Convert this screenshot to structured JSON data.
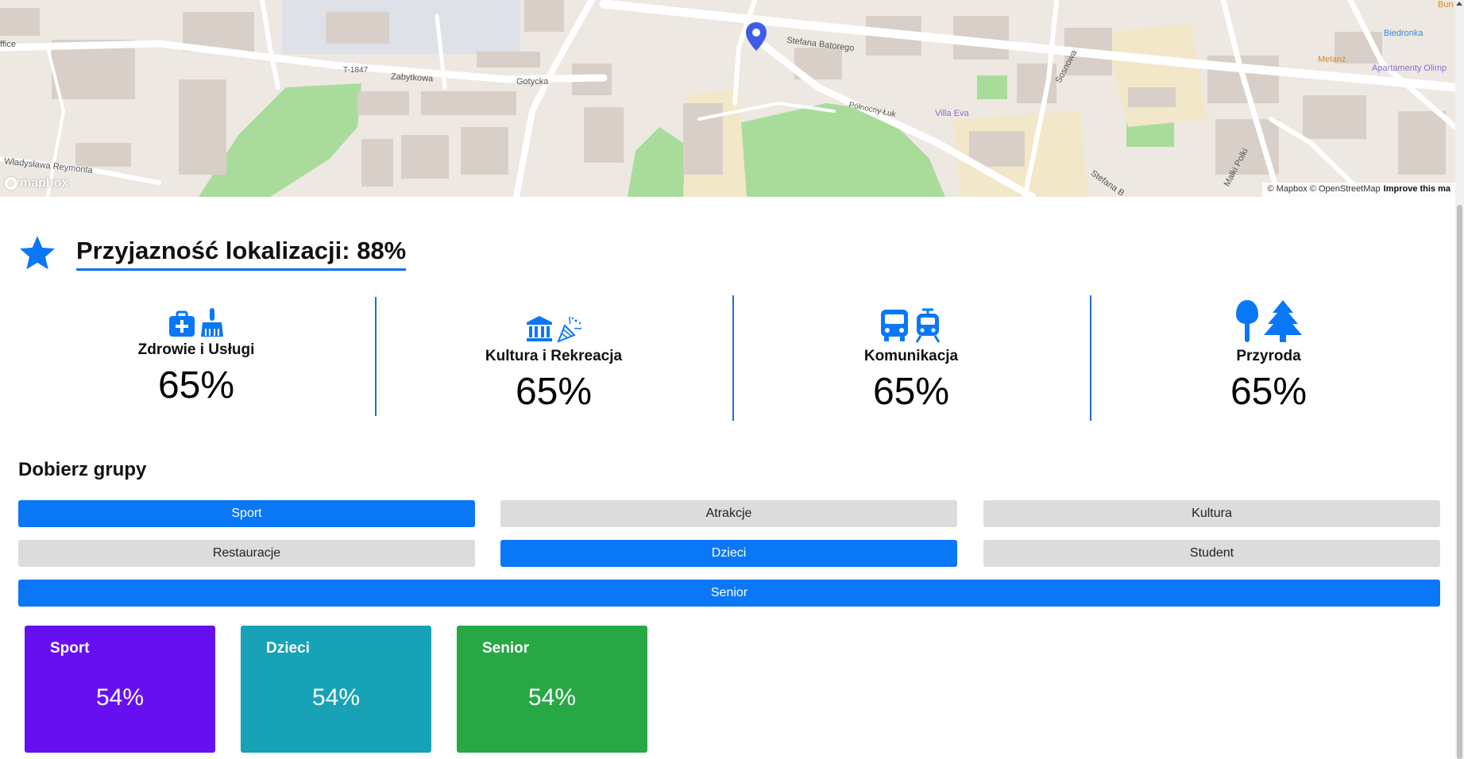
{
  "map": {
    "streets": [
      "Stefana Batorego",
      "Zabytkowa",
      "Gotycka",
      "T-1847",
      "Północny Łuk",
      "Sosnowa",
      "Małki Polki",
      "Stefana B",
      "Władysława Reymonta"
    ],
    "pois": [
      "Villa Eva",
      "Biedronka",
      "Melanż",
      "Apartamenty Olimp",
      "Bun"
    ],
    "edge_text": "ffice",
    "attribution": "© Mapbox © OpenStreetMap",
    "improve_link": "Improve this ma",
    "logo": "mapbox"
  },
  "rating": {
    "title": "Przyjazność lokalizacji: 88%"
  },
  "categories": [
    {
      "label": "Zdrowie i Usługi",
      "value": "65%",
      "icons": [
        "medkit-icon",
        "broom-icon"
      ]
    },
    {
      "label": "Kultura i Rekreacja",
      "value": "65%",
      "icons": [
        "museum-icon",
        "party-icon"
      ]
    },
    {
      "label": "Komunikacja",
      "value": "65%",
      "icons": [
        "bus-icon",
        "train-icon"
      ]
    },
    {
      "label": "Przyroda",
      "value": "65%",
      "icons": [
        "tree-icon",
        "pine-tree-icon"
      ]
    }
  ],
  "groups": {
    "title": "Dobierz grupy",
    "buttons": [
      {
        "label": "Sport",
        "selected": true
      },
      {
        "label": "Atrakcje",
        "selected": false
      },
      {
        "label": "Kultura",
        "selected": false
      },
      {
        "label": "Restauracje",
        "selected": false
      },
      {
        "label": "Dzieci",
        "selected": true
      },
      {
        "label": "Student",
        "selected": false
      },
      {
        "label": "Senior",
        "selected": true
      }
    ]
  },
  "results": [
    {
      "name": "Sport",
      "value": "54%",
      "color": "#6610f2"
    },
    {
      "name": "Dzieci",
      "value": "54%",
      "color": "#17a2b8"
    },
    {
      "name": "Senior",
      "value": "54%",
      "color": "#28a745"
    }
  ],
  "colors": {
    "accent": "#0a77f7",
    "inactive": "#dcdcdc",
    "divider": "#1f6fd6"
  }
}
